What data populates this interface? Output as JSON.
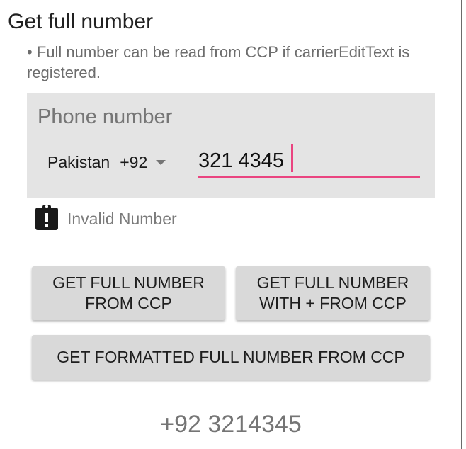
{
  "section": {
    "title": "Get full number",
    "description": "• Full number can be read from CCP if carrierEditText is registered."
  },
  "phone_panel": {
    "heading": "Phone number",
    "country": {
      "name": "Pakistan",
      "code": "+92",
      "arrow_icon": "arrow-drop-down-icon"
    },
    "number_input": {
      "value": "321 4345"
    },
    "accent_color": "#ea4480"
  },
  "validity": {
    "icon": "clipboard-alert-icon",
    "text": "Invalid Number"
  },
  "buttons": {
    "get_full": "GET FULL NUMBER\nFROM CCP",
    "get_full_plus": "GET FULL NUMBER\nWITH + FROM CCP",
    "get_formatted": "GET FORMATTED FULL NUMBER FROM CCP"
  },
  "result": {
    "value": "+92 3214345"
  }
}
